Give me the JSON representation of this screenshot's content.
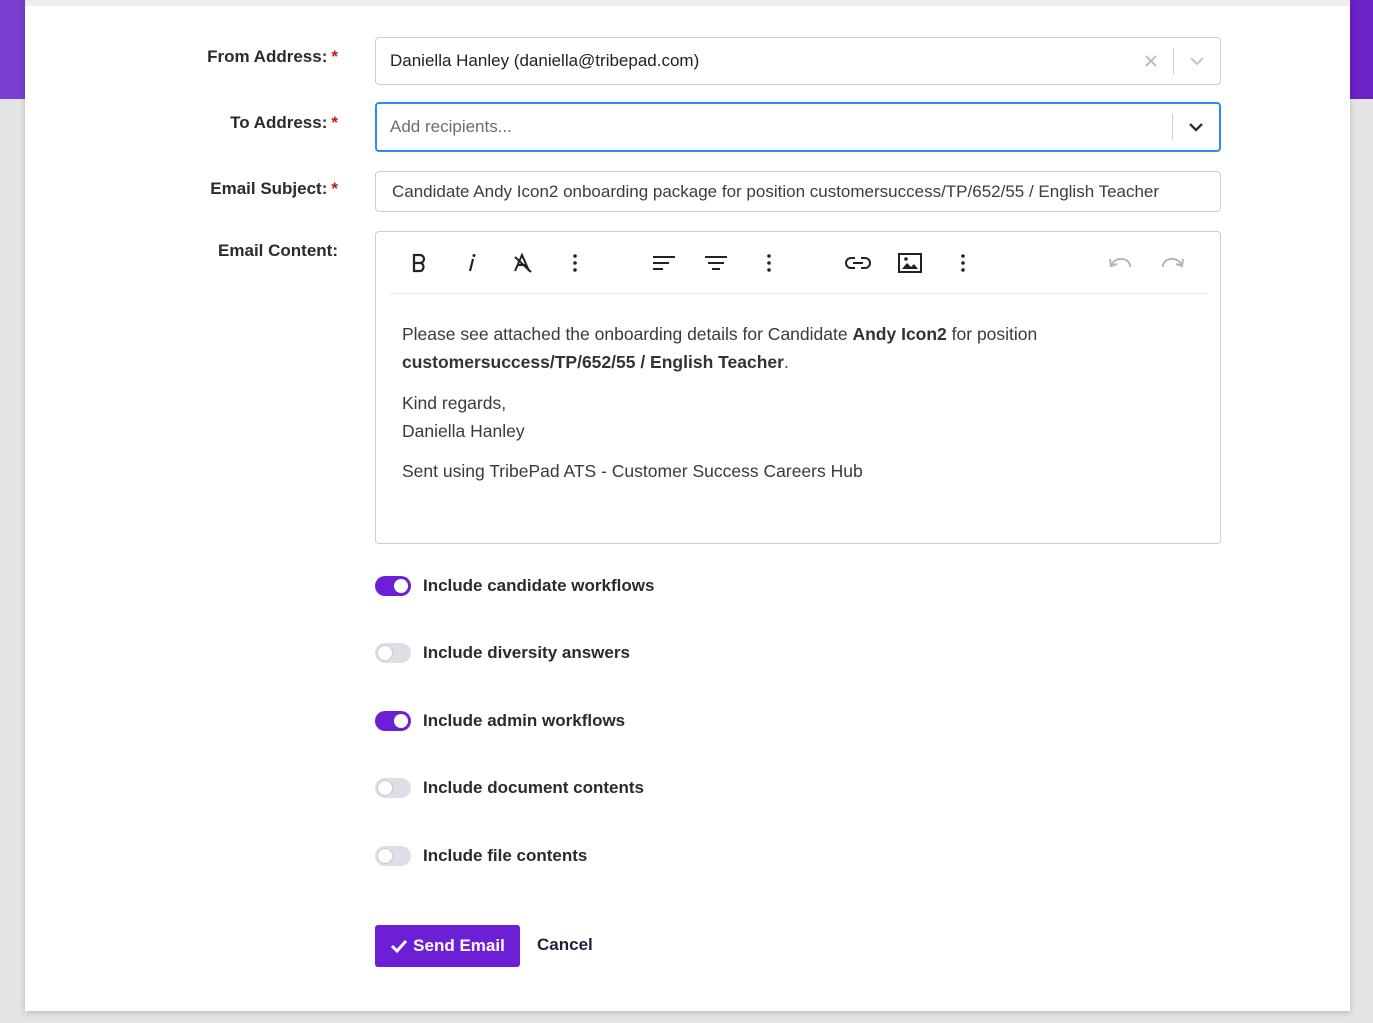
{
  "form": {
    "from_label": "From Address:",
    "to_label": "To Address:",
    "subject_label": "Email Subject:",
    "content_label": "Email Content:",
    "required_marker": "*",
    "from_value": "Daniella Hanley (daniella@tribepad.com)",
    "to_placeholder": "Add recipients...",
    "subject_value": "Candidate Andy Icon2 onboarding package for position customersuccess/TP/652/55 / English Teacher"
  },
  "editor": {
    "toolbar_icons": [
      "bold-icon",
      "italic-icon",
      "clear-format-icon",
      "more-icon",
      "align-left-icon",
      "align-center-icon",
      "more-icon",
      "link-icon",
      "image-icon",
      "more-icon",
      "undo-icon",
      "redo-icon"
    ],
    "line1_prefix": "Please see attached the onboarding details for Candidate ",
    "line1_candidate": "Andy Icon2",
    "line1_suffix": " for position",
    "line2_position": "customersuccess/TP/652/55 / English Teacher",
    "line2_end": ".",
    "regards": "Kind regards,",
    "signature": "Daniella Hanley",
    "sent_using": "Sent using TribePad ATS - Customer Success Careers Hub"
  },
  "options": [
    {
      "label": "Include candidate workflows",
      "on": true
    },
    {
      "label": "Include diversity answers",
      "on": false
    },
    {
      "label": "Include admin workflows",
      "on": true
    },
    {
      "label": "Include document contents",
      "on": false
    },
    {
      "label": "Include file contents",
      "on": false
    }
  ],
  "actions": {
    "send_label": "Send Email",
    "cancel_label": "Cancel"
  },
  "colors": {
    "accent": "#6d1fd6",
    "focus_border": "#2d8cf0",
    "required": "#c0161c"
  }
}
